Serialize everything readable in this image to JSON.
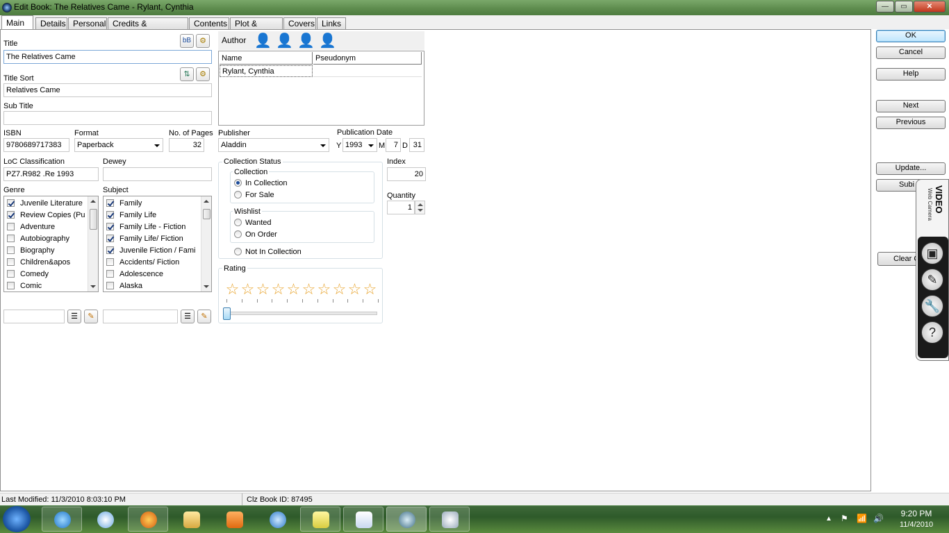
{
  "window": {
    "title": "Edit Book: The Relatives Came - Rylant, Cynthia",
    "min": "—",
    "max": "▭",
    "close": "✕"
  },
  "tabs": [
    {
      "label": "Main"
    },
    {
      "label": "Details"
    },
    {
      "label": "Personal"
    },
    {
      "label": "Credits & Characters"
    },
    {
      "label": "Contents"
    },
    {
      "label": "Plot & Notes"
    },
    {
      "label": "Covers"
    },
    {
      "label": "Links"
    }
  ],
  "form": {
    "title_label": "Title",
    "title_value": "The Relatives Came",
    "title_btn1": "bB",
    "title_sort_label": "Title Sort",
    "title_sort_value": "Relatives Came",
    "sub_title_label": "Sub Title",
    "sub_title_value": "",
    "isbn_label": "ISBN",
    "isbn_value": "9780689717383",
    "format_label": "Format",
    "format_value": "Paperback",
    "pages_label": "No. of Pages",
    "pages_value": "32",
    "loc_label": "LoC Classification",
    "loc_value": "PZ7.R982 .Re 1993",
    "dewey_label": "Dewey",
    "dewey_value": "",
    "genre_label": "Genre",
    "subject_label": "Subject",
    "publisher_label": "Publisher",
    "publisher_value": "Aladdin",
    "pubdate_label": "Publication Date",
    "pub_y_label": "Y",
    "pub_year": "1993",
    "pub_m_label": "M",
    "pub_month": "7",
    "pub_d_label": "D",
    "pub_day": "31",
    "index_label": "Index",
    "index_value": "20",
    "quantity_label": "Quantity",
    "quantity_value": "1"
  },
  "genres": [
    {
      "label": "Juvenile Literature",
      "checked": true
    },
    {
      "label": "Review Copies (Pu",
      "checked": true
    },
    {
      "label": "Adventure",
      "checked": false
    },
    {
      "label": "Autobiography",
      "checked": false
    },
    {
      "label": "Biography",
      "checked": false
    },
    {
      "label": "Children&apos",
      "checked": false
    },
    {
      "label": "Comedy",
      "checked": false
    },
    {
      "label": "Comic",
      "checked": false
    }
  ],
  "subjects": [
    {
      "label": "Family",
      "checked": true
    },
    {
      "label": "Family Life",
      "checked": true
    },
    {
      "label": "Family Life - Fiction",
      "checked": true
    },
    {
      "label": "Family Life/ Fiction",
      "checked": true
    },
    {
      "label": "Juvenile Fiction / Fami",
      "checked": true
    },
    {
      "label": "Accidents/ Fiction",
      "checked": false
    },
    {
      "label": "Adolescence",
      "checked": false
    },
    {
      "label": "Alaska",
      "checked": false
    }
  ],
  "author": {
    "label": "Author",
    "columns": [
      "Name",
      "Pseudonym"
    ],
    "rows": [
      {
        "name": "Rylant, Cynthia",
        "pseudonym": ""
      }
    ]
  },
  "collection_status": {
    "label": "Collection Status",
    "collection_label": "Collection",
    "in_collection": "In Collection",
    "for_sale": "For Sale",
    "wishlist_label": "Wishlist",
    "wanted": "Wanted",
    "on_order": "On Order",
    "not_in_collection": "Not In Collection",
    "selected": "In Collection"
  },
  "rating": {
    "label": "Rating",
    "stars_total": 10,
    "value": 0
  },
  "buttons": {
    "ok": "OK",
    "cancel": "Cancel",
    "help": "Help",
    "next": "Next",
    "previous": "Previous",
    "update": "Update...",
    "submit": "Subi",
    "clear": "Clear C"
  },
  "video_panel": {
    "title": "VIDEO",
    "subtitle": "Web Camera"
  },
  "status": {
    "last_modified": "Last Modified: 11/3/2010 8:03:10 PM",
    "clz_id": "Clz Book ID: 87495"
  },
  "taskbar": {
    "time": "9:20 PM",
    "date": "11/4/2010"
  },
  "colors": {
    "titlebar": "#5c8a4c",
    "taskbar": "#2e5a2a",
    "star": "#e8a530"
  }
}
